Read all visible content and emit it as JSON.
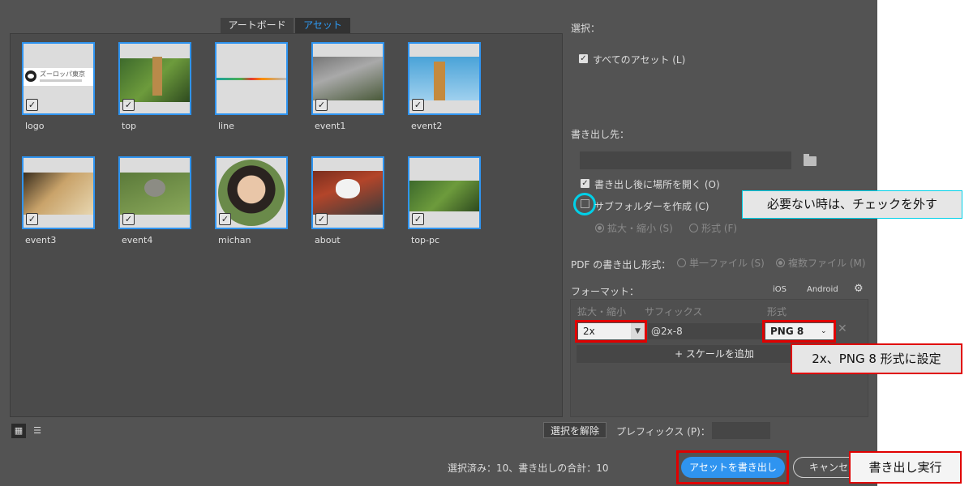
{
  "tabs": {
    "artboard": "アートボード",
    "asset": "アセット"
  },
  "assets": [
    {
      "name": "logo"
    },
    {
      "name": "top"
    },
    {
      "name": "line"
    },
    {
      "name": "event1"
    },
    {
      "name": "event2"
    },
    {
      "name": "event3"
    },
    {
      "name": "event4"
    },
    {
      "name": "michan"
    },
    {
      "name": "about"
    },
    {
      "name": "top-pc"
    }
  ],
  "logo_text": "ズーロッパ東京",
  "select": {
    "label": "選択：",
    "all_assets": "すべてのアセット (L)"
  },
  "export_to": {
    "label": "書き出し先：",
    "path": "",
    "open_after": "書き出し後に場所を開く (O)",
    "subfolder": "サブフォルダーを作成 (C)",
    "opt_scale": "拡大・縮小 (S)",
    "opt_format": "形式 (F)"
  },
  "pdf": {
    "label": "PDF の書き出し形式：",
    "single": "単一ファイル (S)",
    "multi": "複数ファイル (M)"
  },
  "formats": {
    "label": "フォーマット：",
    "ios": "iOS",
    "android": "Android",
    "col_scale": "拡大・縮小",
    "col_suffix": "サフィックス",
    "col_format": "形式",
    "scale": "2x",
    "suffix": "@2x-8",
    "format": "PNG 8",
    "add_scale": "+ スケールを追加"
  },
  "bottom": {
    "deselect": "選択を解除",
    "prefix_label": "プレフィックス (P)：",
    "prefix_value": "",
    "status": "選択済み：10、書き出しの合計：10",
    "export": "アセットを書き出し",
    "cancel": "キャンセル"
  },
  "callouts": {
    "uncheck": "必要ない時は、チェックを外す",
    "format": "2x、PNG 8 形式に設定",
    "run": "書き出し実行"
  },
  "colors": {
    "accent": "#2f94f0",
    "annotation_red": "#e00000",
    "annotation_cyan": "#00d0e8"
  }
}
